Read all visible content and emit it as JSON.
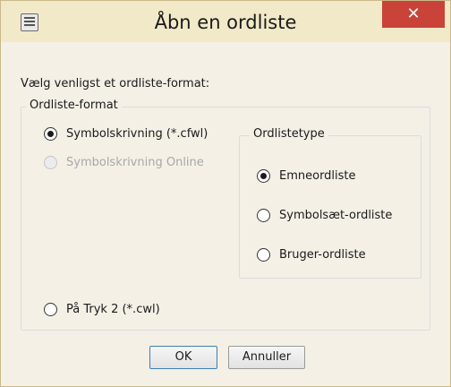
{
  "window": {
    "title": "Åbn en ordliste",
    "close_symbol": "✕"
  },
  "prompt": "Vælg venligst et ordliste-format:",
  "format_group": {
    "label": "Ordliste-format",
    "options": [
      {
        "label": "Symbolskrivning (*.cfwl)",
        "checked": true,
        "enabled": true
      },
      {
        "label": "Symbolskrivning Online",
        "checked": false,
        "enabled": false
      },
      {
        "label": "På Tryk 2 (*.cwl)",
        "checked": false,
        "enabled": true
      }
    ]
  },
  "type_group": {
    "label": "Ordlistetype",
    "options": [
      {
        "label": "Emneordliste",
        "checked": true
      },
      {
        "label": "Symbolsæt-ordliste",
        "checked": false
      },
      {
        "label": "Bruger-ordliste",
        "checked": false
      }
    ]
  },
  "buttons": {
    "ok": "OK",
    "cancel": "Annuller"
  },
  "icons": {
    "app": "list-icon",
    "close": "close-icon"
  },
  "colors": {
    "titlebar": "#f1e9c8",
    "close": "#c94338",
    "background": "#f4f0e6"
  }
}
